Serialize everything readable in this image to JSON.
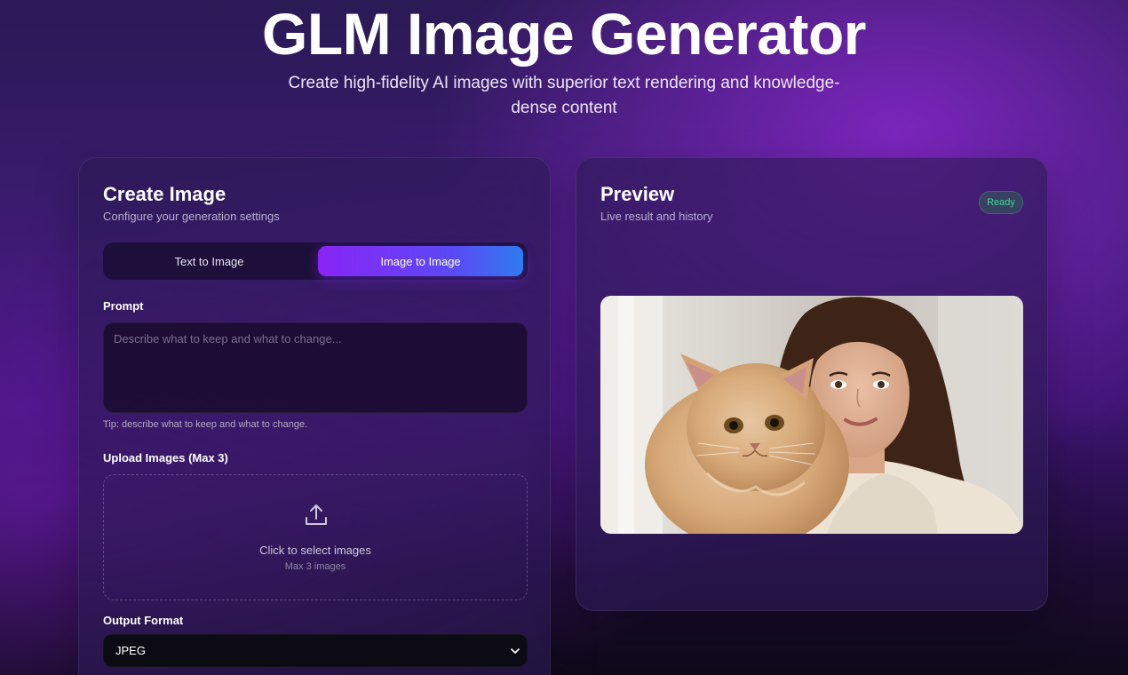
{
  "hero": {
    "title": "GLM Image Generator",
    "subtitle": "Create high-fidelity AI images with superior text rendering and knowledge-dense content"
  },
  "create_panel": {
    "title": "Create Image",
    "subtitle": "Configure your generation settings",
    "tabs": [
      {
        "label": "Text to Image",
        "active": false
      },
      {
        "label": "Image to Image",
        "active": true
      }
    ],
    "prompt": {
      "label": "Prompt",
      "value": "",
      "placeholder": "Describe what to keep and what to change...",
      "tip": "Tip: describe what to keep and what to change."
    },
    "upload": {
      "label": "Upload Images (Max 3)",
      "main_text": "Click to select images",
      "sub_text": "Max 3 images",
      "icon": "upload-icon"
    },
    "output_format": {
      "label": "Output Format",
      "selected": "JPEG",
      "icon": "chevron-down-icon"
    }
  },
  "preview_panel": {
    "title": "Preview",
    "subtitle": "Live result and history",
    "status": "Ready",
    "image_subject": "woman-with-cat-photo"
  },
  "colors": {
    "accent_start": "#8a24f5",
    "accent_end": "#2f7bf0",
    "status_ready": "#42d695",
    "panel_bg": "#2c1a54"
  }
}
